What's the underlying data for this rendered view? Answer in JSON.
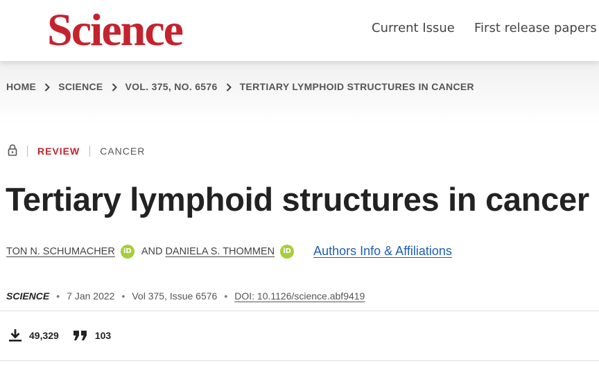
{
  "header": {
    "logo": "Science",
    "nav": [
      "Current Issue",
      "First release papers"
    ]
  },
  "breadcrumb": [
    "HOME",
    "SCIENCE",
    "VOL. 375, NO. 6576",
    "TERTIARY LYMPHOID STRUCTURES IN CANCER"
  ],
  "article": {
    "access_icon": "lock-icon",
    "type": "REVIEW",
    "subject": "CANCER",
    "title": "Tertiary lymphoid structures in cancer",
    "authors": [
      "TON N. SCHUMACHER",
      "DANIELA S. THOMMEN"
    ],
    "and": "AND",
    "orcid_label": "iD",
    "affiliations_link": "Authors Info & Affiliations",
    "journal": "SCIENCE",
    "date": "7 Jan 2022",
    "volume": "Vol 375, Issue 6576",
    "doi": "DOI: 10.1126/science.abf9419"
  },
  "metrics": {
    "downloads": "49,329",
    "citations": "103"
  },
  "colors": {
    "brand": "#c4232e",
    "link": "#1d5fb5",
    "orcid": "#a6ce39"
  }
}
